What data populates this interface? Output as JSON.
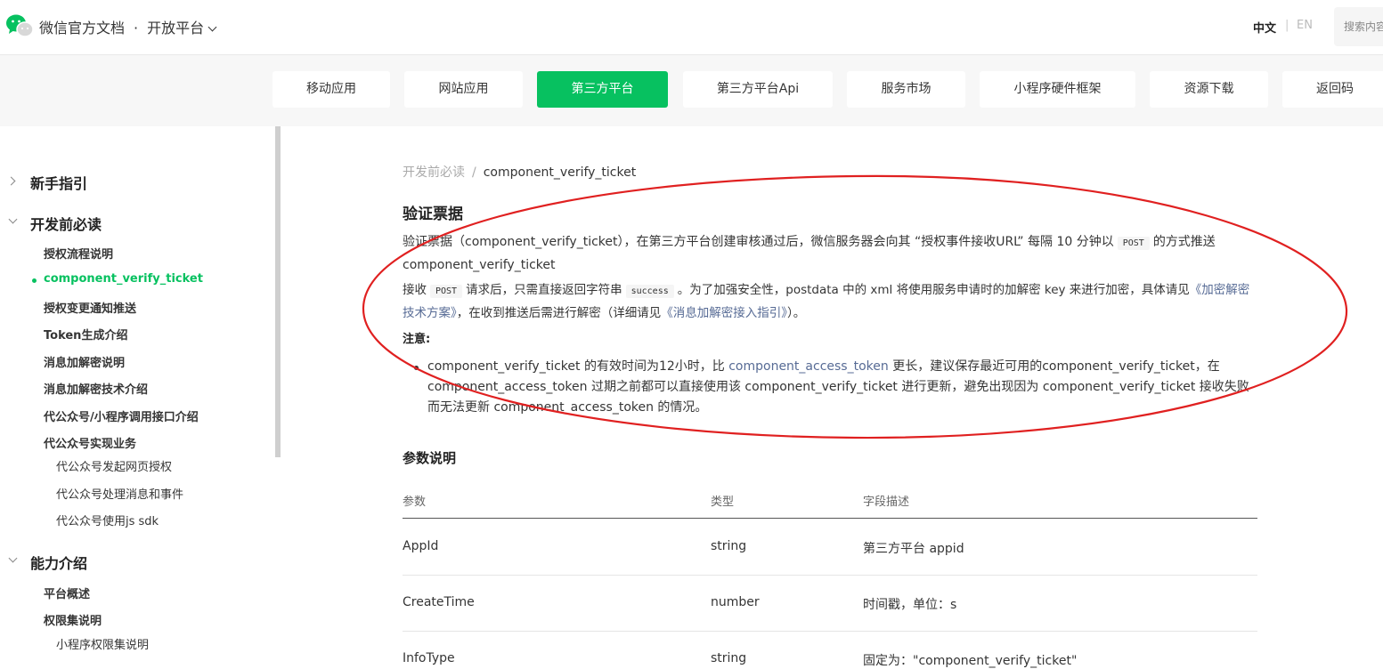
{
  "header": {
    "brand": "微信官方文档",
    "dot": "·",
    "product": "开放平台",
    "lang_zh": "中文",
    "lang_sep": "|",
    "lang_en": "EN",
    "search_placeholder": "搜索内容"
  },
  "tabs": [
    {
      "label": "移动应用"
    },
    {
      "label": "网站应用"
    },
    {
      "label": "第三方平台",
      "active": true
    },
    {
      "label": "第三方平台Api"
    },
    {
      "label": "服务市场"
    },
    {
      "label": "小程序硬件框架"
    },
    {
      "label": "资源下载"
    },
    {
      "label": "返回码"
    }
  ],
  "sidebar": {
    "sections": [
      {
        "label": "新手指引",
        "expanded": false
      },
      {
        "label": "开发前必读",
        "expanded": true
      },
      {
        "label": "能力介绍",
        "expanded": true
      }
    ],
    "items": [
      "授权流程说明",
      "component_verify_ticket",
      "授权变更通知推送",
      "Token生成介绍",
      "消息加解密说明",
      "消息加解密技术介绍",
      "代公众号/小程序调用接口介绍",
      "代公众号实现业务",
      "代公众号发起网页授权",
      "代公众号处理消息和事件",
      "代公众号使用js sdk",
      "平台概述",
      "权限集说明",
      "小程序权限集说明"
    ]
  },
  "breadcrumb": {
    "parent": "开发前必读",
    "sep": "/",
    "current": "component_verify_ticket"
  },
  "content": {
    "title": "验证票据",
    "p1_a": "验证票据（component_verify_ticket），在第三方平台创建审核通过后，微信服务器会向其 “授权事件接收URL” 每隔 10 分钟以",
    "p1_code": "POST",
    "p1_b": "的方式推送 component_verify_ticket",
    "p2_a": "接收",
    "p2_code1": "POST",
    "p2_b": "请求后，只需直接返回字符串",
    "p2_code2": "success",
    "p2_c": "。为了加强安全性，postdata 中的 xml 将使用服务申请时的加解密 key 来进行加密，具体请见",
    "p2_link1": "《加密解密技术方案》",
    "p2_d": "，在收到推送后需进行解密（详细请见",
    "p2_link2": "《消息加解密接入指引》",
    "p2_e": "）。",
    "note": "注意:",
    "bullet_a": "component_verify_ticket 的有效时间为12小时，比",
    "bullet_link": "component_access_token",
    "bullet_b": "更长，建议保存最近可用的component_verify_ticket，在 component_access_token 过期之前都可以直接使用该 component_verify_ticket 进行更新，避免出现因为 component_verify_ticket 接收失败而无法更新 component_access_token 的情况。",
    "params_title": "参数说明"
  },
  "table": {
    "headers": [
      "参数",
      "类型",
      "字段描述"
    ],
    "rows": [
      [
        "AppId",
        "string",
        "第三方平台 appid"
      ],
      [
        "CreateTime",
        "number",
        "时间戳，单位：s"
      ],
      [
        "InfoType",
        "string",
        "固定为：\"component_verify_ticket\""
      ]
    ]
  },
  "colors": {
    "accent": "#07c160",
    "annotation": "#e02020",
    "link": "#576b95"
  }
}
